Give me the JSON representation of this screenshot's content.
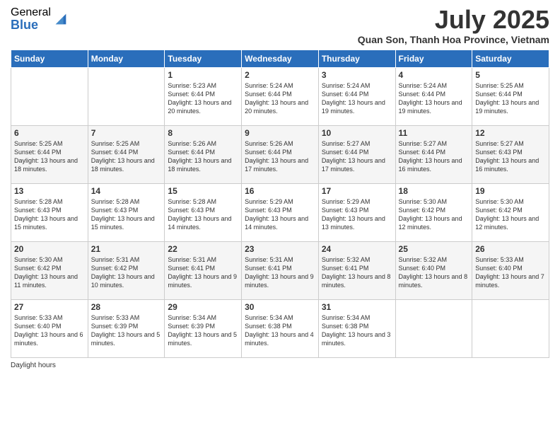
{
  "logo": {
    "general": "General",
    "blue": "Blue"
  },
  "title": "July 2025",
  "location": "Quan Son, Thanh Hoa Province, Vietnam",
  "days_of_week": [
    "Sunday",
    "Monday",
    "Tuesday",
    "Wednesday",
    "Thursday",
    "Friday",
    "Saturday"
  ],
  "weeks": [
    [
      {
        "day": "",
        "sunrise": "",
        "sunset": "",
        "daylight": ""
      },
      {
        "day": "",
        "sunrise": "",
        "sunset": "",
        "daylight": ""
      },
      {
        "day": "1",
        "sunrise": "Sunrise: 5:23 AM",
        "sunset": "Sunset: 6:44 PM",
        "daylight": "Daylight: 13 hours and 20 minutes."
      },
      {
        "day": "2",
        "sunrise": "Sunrise: 5:24 AM",
        "sunset": "Sunset: 6:44 PM",
        "daylight": "Daylight: 13 hours and 20 minutes."
      },
      {
        "day": "3",
        "sunrise": "Sunrise: 5:24 AM",
        "sunset": "Sunset: 6:44 PM",
        "daylight": "Daylight: 13 hours and 19 minutes."
      },
      {
        "day": "4",
        "sunrise": "Sunrise: 5:24 AM",
        "sunset": "Sunset: 6:44 PM",
        "daylight": "Daylight: 13 hours and 19 minutes."
      },
      {
        "day": "5",
        "sunrise": "Sunrise: 5:25 AM",
        "sunset": "Sunset: 6:44 PM",
        "daylight": "Daylight: 13 hours and 19 minutes."
      }
    ],
    [
      {
        "day": "6",
        "sunrise": "Sunrise: 5:25 AM",
        "sunset": "Sunset: 6:44 PM",
        "daylight": "Daylight: 13 hours and 18 minutes."
      },
      {
        "day": "7",
        "sunrise": "Sunrise: 5:25 AM",
        "sunset": "Sunset: 6:44 PM",
        "daylight": "Daylight: 13 hours and 18 minutes."
      },
      {
        "day": "8",
        "sunrise": "Sunrise: 5:26 AM",
        "sunset": "Sunset: 6:44 PM",
        "daylight": "Daylight: 13 hours and 18 minutes."
      },
      {
        "day": "9",
        "sunrise": "Sunrise: 5:26 AM",
        "sunset": "Sunset: 6:44 PM",
        "daylight": "Daylight: 13 hours and 17 minutes."
      },
      {
        "day": "10",
        "sunrise": "Sunrise: 5:27 AM",
        "sunset": "Sunset: 6:44 PM",
        "daylight": "Daylight: 13 hours and 17 minutes."
      },
      {
        "day": "11",
        "sunrise": "Sunrise: 5:27 AM",
        "sunset": "Sunset: 6:44 PM",
        "daylight": "Daylight: 13 hours and 16 minutes."
      },
      {
        "day": "12",
        "sunrise": "Sunrise: 5:27 AM",
        "sunset": "Sunset: 6:43 PM",
        "daylight": "Daylight: 13 hours and 16 minutes."
      }
    ],
    [
      {
        "day": "13",
        "sunrise": "Sunrise: 5:28 AM",
        "sunset": "Sunset: 6:43 PM",
        "daylight": "Daylight: 13 hours and 15 minutes."
      },
      {
        "day": "14",
        "sunrise": "Sunrise: 5:28 AM",
        "sunset": "Sunset: 6:43 PM",
        "daylight": "Daylight: 13 hours and 15 minutes."
      },
      {
        "day": "15",
        "sunrise": "Sunrise: 5:28 AM",
        "sunset": "Sunset: 6:43 PM",
        "daylight": "Daylight: 13 hours and 14 minutes."
      },
      {
        "day": "16",
        "sunrise": "Sunrise: 5:29 AM",
        "sunset": "Sunset: 6:43 PM",
        "daylight": "Daylight: 13 hours and 14 minutes."
      },
      {
        "day": "17",
        "sunrise": "Sunrise: 5:29 AM",
        "sunset": "Sunset: 6:43 PM",
        "daylight": "Daylight: 13 hours and 13 minutes."
      },
      {
        "day": "18",
        "sunrise": "Sunrise: 5:30 AM",
        "sunset": "Sunset: 6:42 PM",
        "daylight": "Daylight: 13 hours and 12 minutes."
      },
      {
        "day": "19",
        "sunrise": "Sunrise: 5:30 AM",
        "sunset": "Sunset: 6:42 PM",
        "daylight": "Daylight: 13 hours and 12 minutes."
      }
    ],
    [
      {
        "day": "20",
        "sunrise": "Sunrise: 5:30 AM",
        "sunset": "Sunset: 6:42 PM",
        "daylight": "Daylight: 13 hours and 11 minutes."
      },
      {
        "day": "21",
        "sunrise": "Sunrise: 5:31 AM",
        "sunset": "Sunset: 6:42 PM",
        "daylight": "Daylight: 13 hours and 10 minutes."
      },
      {
        "day": "22",
        "sunrise": "Sunrise: 5:31 AM",
        "sunset": "Sunset: 6:41 PM",
        "daylight": "Daylight: 13 hours and 9 minutes."
      },
      {
        "day": "23",
        "sunrise": "Sunrise: 5:31 AM",
        "sunset": "Sunset: 6:41 PM",
        "daylight": "Daylight: 13 hours and 9 minutes."
      },
      {
        "day": "24",
        "sunrise": "Sunrise: 5:32 AM",
        "sunset": "Sunset: 6:41 PM",
        "daylight": "Daylight: 13 hours and 8 minutes."
      },
      {
        "day": "25",
        "sunrise": "Sunrise: 5:32 AM",
        "sunset": "Sunset: 6:40 PM",
        "daylight": "Daylight: 13 hours and 8 minutes."
      },
      {
        "day": "26",
        "sunrise": "Sunrise: 5:33 AM",
        "sunset": "Sunset: 6:40 PM",
        "daylight": "Daylight: 13 hours and 7 minutes."
      }
    ],
    [
      {
        "day": "27",
        "sunrise": "Sunrise: 5:33 AM",
        "sunset": "Sunset: 6:40 PM",
        "daylight": "Daylight: 13 hours and 6 minutes."
      },
      {
        "day": "28",
        "sunrise": "Sunrise: 5:33 AM",
        "sunset": "Sunset: 6:39 PM",
        "daylight": "Daylight: 13 hours and 5 minutes."
      },
      {
        "day": "29",
        "sunrise": "Sunrise: 5:34 AM",
        "sunset": "Sunset: 6:39 PM",
        "daylight": "Daylight: 13 hours and 5 minutes."
      },
      {
        "day": "30",
        "sunrise": "Sunrise: 5:34 AM",
        "sunset": "Sunset: 6:38 PM",
        "daylight": "Daylight: 13 hours and 4 minutes."
      },
      {
        "day": "31",
        "sunrise": "Sunrise: 5:34 AM",
        "sunset": "Sunset: 6:38 PM",
        "daylight": "Daylight: 13 hours and 3 minutes."
      },
      {
        "day": "",
        "sunrise": "",
        "sunset": "",
        "daylight": ""
      },
      {
        "day": "",
        "sunrise": "",
        "sunset": "",
        "daylight": ""
      }
    ]
  ],
  "footer": {
    "daylight_label": "Daylight hours"
  }
}
